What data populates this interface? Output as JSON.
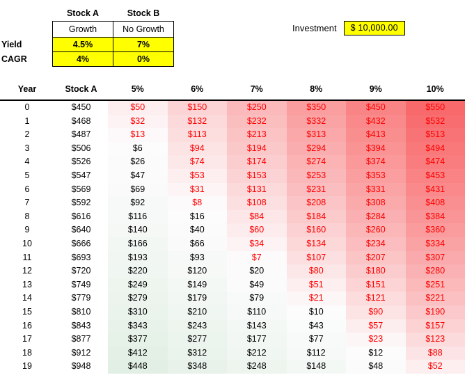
{
  "assumptions": {
    "col_headers": [
      "Stock A",
      "Stock B"
    ],
    "type_row": [
      "Growth",
      "No Growth"
    ],
    "rows": [
      {
        "label": "Yield",
        "values": [
          "4.5%",
          "7%"
        ]
      },
      {
        "label": "CAGR",
        "values": [
          "4%",
          "0%"
        ]
      }
    ]
  },
  "investment": {
    "label": "Investment",
    "value": "$ 10,000.00"
  },
  "colors": {
    "highlight": "#ffff00",
    "negative_text": "#ff0000",
    "positive_text": "#000000",
    "heat_max_red": "#f8696b",
    "heat_mid_white": "#fcfcfc",
    "heat_min_green": "#e2efe4"
  },
  "chart_data": {
    "type": "heatmap",
    "title": "",
    "xlabel": "",
    "ylabel": "Year",
    "columns": [
      "Year",
      "Stock A",
      "5%",
      "6%",
      "7%",
      "8%",
      "9%",
      "10%"
    ],
    "rate_columns": [
      "5%",
      "6%",
      "7%",
      "8%",
      "9%",
      "10%"
    ],
    "row_labels": [
      "0",
      "1",
      "2",
      "3",
      "4",
      "5",
      "6",
      "7",
      "8",
      "9",
      "10",
      "11",
      "12",
      "13",
      "14",
      "15",
      "16",
      "17",
      "18",
      "19"
    ],
    "stock_a": [
      "$450",
      "$468",
      "$487",
      "$506",
      "$526",
      "$547",
      "$569",
      "$592",
      "$616",
      "$640",
      "$666",
      "$693",
      "$720",
      "$749",
      "$779",
      "$810",
      "$843",
      "$877",
      "$912",
      "$948"
    ],
    "stock_a_values": [
      450,
      468,
      487,
      506,
      526,
      547,
      569,
      592,
      616,
      640,
      666,
      693,
      720,
      749,
      779,
      810,
      843,
      877,
      912,
      948
    ],
    "cells": [
      {
        "year": "0",
        "values": [
          "$50",
          "$150",
          "$250",
          "$350",
          "$450",
          "$550"
        ],
        "nums": [
          50,
          150,
          250,
          350,
          450,
          550
        ],
        "neg": [
          true,
          true,
          true,
          true,
          true,
          true
        ]
      },
      {
        "year": "1",
        "values": [
          "$32",
          "$132",
          "$232",
          "$332",
          "$432",
          "$532"
        ],
        "nums": [
          32,
          132,
          232,
          332,
          432,
          532
        ],
        "neg": [
          true,
          true,
          true,
          true,
          true,
          true
        ]
      },
      {
        "year": "2",
        "values": [
          "$13",
          "$113",
          "$213",
          "$313",
          "$413",
          "$513"
        ],
        "nums": [
          13,
          113,
          213,
          313,
          413,
          513
        ],
        "neg": [
          true,
          true,
          true,
          true,
          true,
          true
        ]
      },
      {
        "year": "3",
        "values": [
          "$6",
          "$94",
          "$194",
          "$294",
          "$394",
          "$494"
        ],
        "nums": [
          6,
          94,
          194,
          294,
          394,
          494
        ],
        "neg": [
          false,
          true,
          true,
          true,
          true,
          true
        ]
      },
      {
        "year": "4",
        "values": [
          "$26",
          "$74",
          "$174",
          "$274",
          "$374",
          "$474"
        ],
        "nums": [
          26,
          74,
          174,
          274,
          374,
          474
        ],
        "neg": [
          false,
          true,
          true,
          true,
          true,
          true
        ]
      },
      {
        "year": "5",
        "values": [
          "$47",
          "$53",
          "$153",
          "$253",
          "$353",
          "$453"
        ],
        "nums": [
          47,
          53,
          153,
          253,
          353,
          453
        ],
        "neg": [
          false,
          true,
          true,
          true,
          true,
          true
        ]
      },
      {
        "year": "6",
        "values": [
          "$69",
          "$31",
          "$131",
          "$231",
          "$331",
          "$431"
        ],
        "nums": [
          69,
          31,
          131,
          231,
          331,
          431
        ],
        "neg": [
          false,
          true,
          true,
          true,
          true,
          true
        ]
      },
      {
        "year": "7",
        "values": [
          "$92",
          "$8",
          "$108",
          "$208",
          "$308",
          "$408"
        ],
        "nums": [
          92,
          8,
          108,
          208,
          308,
          408
        ],
        "neg": [
          false,
          true,
          true,
          true,
          true,
          true
        ]
      },
      {
        "year": "8",
        "values": [
          "$116",
          "$16",
          "$84",
          "$184",
          "$284",
          "$384"
        ],
        "nums": [
          116,
          16,
          84,
          184,
          284,
          384
        ],
        "neg": [
          false,
          false,
          true,
          true,
          true,
          true
        ]
      },
      {
        "year": "9",
        "values": [
          "$140",
          "$40",
          "$60",
          "$160",
          "$260",
          "$360"
        ],
        "nums": [
          140,
          40,
          60,
          160,
          260,
          360
        ],
        "neg": [
          false,
          false,
          true,
          true,
          true,
          true
        ]
      },
      {
        "year": "10",
        "values": [
          "$166",
          "$66",
          "$34",
          "$134",
          "$234",
          "$334"
        ],
        "nums": [
          166,
          66,
          34,
          134,
          234,
          334
        ],
        "neg": [
          false,
          false,
          true,
          true,
          true,
          true
        ]
      },
      {
        "year": "11",
        "values": [
          "$193",
          "$93",
          "$7",
          "$107",
          "$207",
          "$307"
        ],
        "nums": [
          193,
          93,
          7,
          107,
          207,
          307
        ],
        "neg": [
          false,
          false,
          true,
          true,
          true,
          true
        ]
      },
      {
        "year": "12",
        "values": [
          "$220",
          "$120",
          "$20",
          "$80",
          "$180",
          "$280"
        ],
        "nums": [
          220,
          120,
          20,
          80,
          180,
          280
        ],
        "neg": [
          false,
          false,
          false,
          true,
          true,
          true
        ]
      },
      {
        "year": "13",
        "values": [
          "$249",
          "$149",
          "$49",
          "$51",
          "$151",
          "$251"
        ],
        "nums": [
          249,
          149,
          49,
          51,
          151,
          251
        ],
        "neg": [
          false,
          false,
          false,
          true,
          true,
          true
        ]
      },
      {
        "year": "14",
        "values": [
          "$279",
          "$179",
          "$79",
          "$21",
          "$121",
          "$221"
        ],
        "nums": [
          279,
          179,
          79,
          21,
          121,
          221
        ],
        "neg": [
          false,
          false,
          false,
          true,
          true,
          true
        ]
      },
      {
        "year": "15",
        "values": [
          "$310",
          "$210",
          "$110",
          "$10",
          "$90",
          "$190"
        ],
        "nums": [
          310,
          210,
          110,
          10,
          90,
          190
        ],
        "neg": [
          false,
          false,
          false,
          false,
          true,
          true
        ]
      },
      {
        "year": "16",
        "values": [
          "$343",
          "$243",
          "$143",
          "$43",
          "$57",
          "$157"
        ],
        "nums": [
          343,
          243,
          143,
          43,
          57,
          157
        ],
        "neg": [
          false,
          false,
          false,
          false,
          true,
          true
        ]
      },
      {
        "year": "17",
        "values": [
          "$377",
          "$277",
          "$177",
          "$77",
          "$23",
          "$123"
        ],
        "nums": [
          377,
          277,
          177,
          77,
          23,
          123
        ],
        "neg": [
          false,
          false,
          false,
          false,
          true,
          true
        ]
      },
      {
        "year": "18",
        "values": [
          "$412",
          "$312",
          "$212",
          "$112",
          "$12",
          "$88"
        ],
        "nums": [
          412,
          312,
          212,
          112,
          12,
          88
        ],
        "neg": [
          false,
          false,
          false,
          false,
          false,
          true
        ]
      },
      {
        "year": "19",
        "values": [
          "$448",
          "$348",
          "$248",
          "$148",
          "$48",
          "$52"
        ],
        "nums": [
          448,
          348,
          248,
          148,
          48,
          52
        ],
        "neg": [
          false,
          false,
          false,
          false,
          false,
          true
        ]
      }
    ],
    "heat_scale": {
      "min": -448,
      "mid": 0,
      "max": 550,
      "min_color": "#e2efe4",
      "mid_color": "#fdfcfd",
      "max_color": "#f8696b"
    }
  }
}
